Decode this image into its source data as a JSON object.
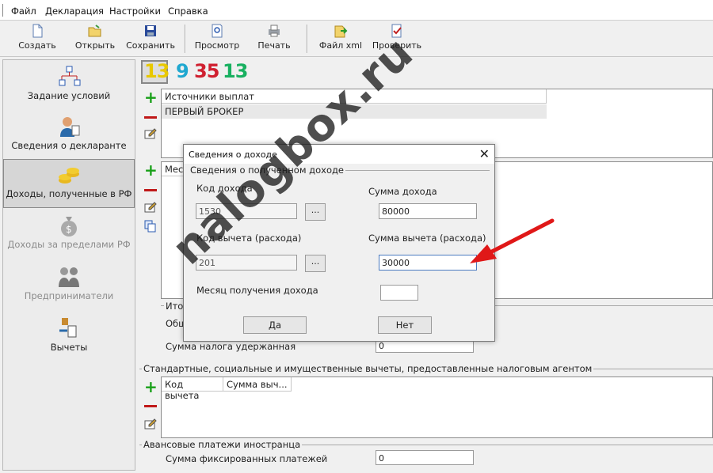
{
  "menu": [
    "Файл",
    "Декларация",
    "Настройки",
    "Справка"
  ],
  "toolbar": {
    "create": "Создать",
    "open": "Открыть",
    "save": "Сохранить",
    "preview": "Просмотр",
    "print": "Печать",
    "xml": "Файл xml",
    "check": "Проверить"
  },
  "sidebar": [
    {
      "label": "Задание условий",
      "icon": "conditions-icon"
    },
    {
      "label": "Сведения о декларанте",
      "icon": "declarant-icon"
    },
    {
      "label": "Доходы, полученные в РФ",
      "icon": "coins-icon"
    },
    {
      "label": "Доходы за пределами РФ",
      "icon": "money-bag-icon"
    },
    {
      "label": "Предприниматели",
      "icon": "handshake-icon"
    },
    {
      "label": "Вычеты",
      "icon": "scales-icon"
    }
  ],
  "counters": [
    "13",
    "9",
    "35",
    "13"
  ],
  "counter_colors": [
    "#e8c800",
    "#20a8d0",
    "#d02030",
    "#18b060"
  ],
  "sources": {
    "header": "Источники выплат",
    "rows": [
      "ПЕРВЫЙ БРОКЕР"
    ]
  },
  "months_header_partial": "Мес",
  "totals": {
    "group_partial": "Ито",
    "total_partial": "Общ",
    "tax_withheld_label": "Сумма налога удержанная",
    "tax_withheld_value": "0"
  },
  "standard_deductions": {
    "group": "Стандартные, социальные и имущественные вычеты, предоставленные налоговым агентом",
    "col_code": "Код вычета",
    "col_sum": "Сумма выч..."
  },
  "advance": {
    "group": "Авансовые платежи иностранца",
    "label": "Сумма фиксированных платежей",
    "value": "0"
  },
  "dialog": {
    "title": "Сведения о доходе",
    "close": "✕",
    "group": "Сведения о полученном доходе",
    "income_code_label": "Код дохода",
    "income_code_value": "1530",
    "income_sum_label": "Сумма дохода",
    "income_sum_value": "80000",
    "deduction_code_label": "Код вычета (расхода)",
    "deduction_code_value": "201",
    "deduction_sum_label": "Сумма вычета (расхода)",
    "deduction_sum_value": "30000",
    "month_label": "Месяц получения дохода",
    "month_value": "",
    "dots": "...",
    "yes": "Да",
    "no": "Нет"
  },
  "watermark": "nalogbox.ru"
}
